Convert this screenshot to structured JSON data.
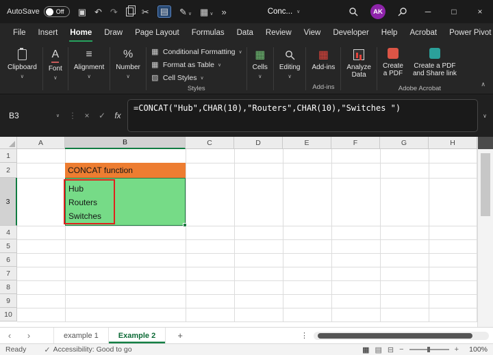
{
  "colors": {
    "accent_green": "#107c41",
    "menu_underline_green": "#27a35f",
    "orange_fill": "#ed7d31",
    "green_fill": "#76db87",
    "red_annotation": "#e0201c",
    "avatar_purple": "#8e24aa",
    "addins_red": "#e4443c"
  },
  "icons": {
    "save": "▣",
    "undo": "↶",
    "redo": "↷",
    "cut": "✂",
    "paste": "▤",
    "format_painter": "✎",
    "borders_grid": "▦",
    "overflow": "»",
    "chevron_down": "∨",
    "collapse_ribbon": "∧",
    "minimize": "─",
    "maximize": "□",
    "close": "×",
    "tab_prev": "‹",
    "tab_next": "›",
    "add_sheet": "+",
    "dots_vertical": "⋮",
    "cancel": "×",
    "enter": "✓",
    "view_normal": "▦",
    "view_page_layout": "▤",
    "view_page_break": "⊟",
    "zoom_out": "−",
    "zoom_in": "+",
    "accessibility_check": "✓",
    "cond_format": "▦",
    "format_table": "▦",
    "cell_styles": "▨",
    "cells": "▦",
    "font": "A",
    "alignment": "≡",
    "number": "%",
    "addins": "▦"
  },
  "window": {
    "autosave_label": "AutoSave",
    "autosave_state": "Off",
    "doc_title": "Conc...",
    "avatar": "AK"
  },
  "menu": {
    "items": [
      "File",
      "Insert",
      "Home",
      "Draw",
      "Page Layout",
      "Formulas",
      "Data",
      "Review",
      "View",
      "Developer",
      "Help",
      "Acrobat",
      "Power Pivot"
    ]
  },
  "ribbon": {
    "clipboard_label": "Clipboard",
    "font_label": "Font",
    "alignment_label": "Alignment",
    "number_label": "Number",
    "conditional_formatting": "Conditional Formatting",
    "format_as_table": "Format as Table",
    "cell_styles": "Cell Styles",
    "styles_group": "Styles",
    "cells_label": "Cells",
    "editing_label": "Editing",
    "addins_label": "Add-ins",
    "addins_group": "Add-ins",
    "analyze_line1": "Analyze",
    "analyze_line2": "Data",
    "pdf_line1": "Create",
    "pdf_line2": "a PDF",
    "pdf_share_line1": "Create a PDF",
    "pdf_share_line2": "and Share link",
    "acrobat_group": "Adobe Acrobat"
  },
  "formula_bar": {
    "name_box": "B3",
    "fx_label": "fx",
    "formula": "=CONCAT(\"Hub\",CHAR(10),\"Routers\",CHAR(10),\"Switches \")"
  },
  "sheet": {
    "col_headers": [
      "A",
      "B",
      "C",
      "D",
      "E",
      "F",
      "G",
      "H"
    ],
    "row_headers": [
      "1",
      "2",
      "3",
      "4",
      "5",
      "6",
      "7",
      "8",
      "9",
      "10"
    ],
    "b2_text": "CONCAT function",
    "b3_line1": "Hub",
    "b3_line2": "Routers",
    "b3_line3": "Switches"
  },
  "tabs": {
    "sheet1": "example 1",
    "sheet2": "Example 2"
  },
  "status": {
    "ready": "Ready",
    "accessibility": "Accessibility: Good to go",
    "zoom": "100%"
  }
}
